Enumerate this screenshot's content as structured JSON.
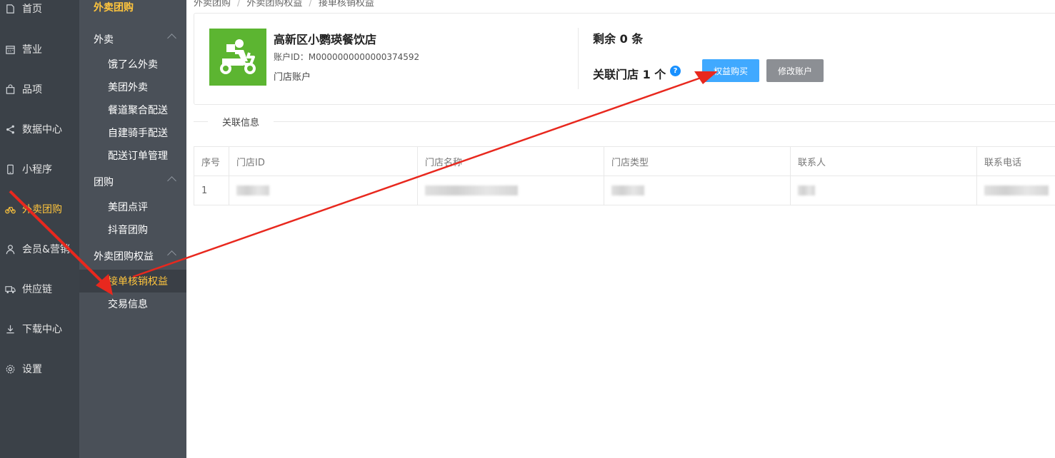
{
  "rail": {
    "items": [
      {
        "label": "首页",
        "icon": "home-icon"
      },
      {
        "label": "营业",
        "icon": "calendar-icon"
      },
      {
        "label": "品项",
        "icon": "bag-icon"
      },
      {
        "label": "数据中心",
        "icon": "share-icon"
      },
      {
        "label": "小程序",
        "icon": "phone-icon"
      },
      {
        "label": "外卖团购",
        "icon": "bike-icon"
      },
      {
        "label": "会员&营销",
        "icon": "user-icon"
      },
      {
        "label": "供应链",
        "icon": "truck-icon"
      },
      {
        "label": "下载中心",
        "icon": "download-icon"
      },
      {
        "label": "设置",
        "icon": "gear-icon"
      }
    ]
  },
  "submenu": {
    "header": "外卖团购",
    "group_waimai": "外卖",
    "waimai_items": [
      "饿了么外卖",
      "美团外卖",
      "餐道聚合配送",
      "自建骑手配送",
      "配送订单管理"
    ],
    "group_tuangou": "团购",
    "tuangou_items": [
      "美团点评",
      "抖音团购"
    ],
    "group_quanyi": "外卖团购权益",
    "quanyi_items": [
      "接单核销权益",
      "交易信息"
    ]
  },
  "breadcrumb": {
    "l1": "外卖团购",
    "l2": "外卖团购权益",
    "l3": "接单核销权益"
  },
  "account": {
    "shop_name": "高新区小鹦瑛餐饮店",
    "account_id": "账户ID：M0000000000000374592",
    "account_type": "门店账户",
    "remaining": "剩余 0 条",
    "linked_stores": "关联门店 1 个",
    "help_mark": "?",
    "buy_button": "权益购买",
    "edit_button": "修改账户"
  },
  "section_title": "关联信息",
  "table": {
    "headers": [
      "序号",
      "门店ID",
      "门店名称",
      "门店类型",
      "联系人",
      "联系电话"
    ],
    "rows": [
      {
        "index": "1"
      }
    ]
  },
  "colors": {
    "accent": "#ffc53d",
    "primary_button": "#40a9ff",
    "annotation_arrow": "#e8281e"
  }
}
